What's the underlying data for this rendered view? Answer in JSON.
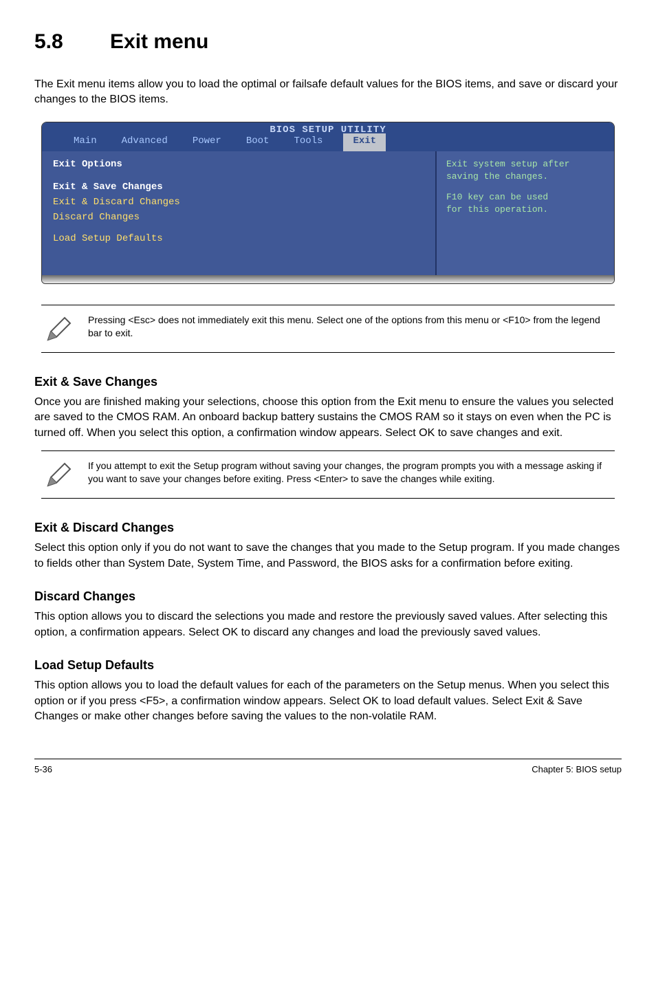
{
  "heading": {
    "number": "5.8",
    "title": "Exit menu"
  },
  "intro": "The Exit menu items allow you to load the optimal or failsafe default values for the BIOS items, and save or discard your changes to the BIOS items.",
  "bios": {
    "title": "BIOS SETUP UTILITY",
    "tabs": [
      "Main",
      "Advanced",
      "Power",
      "Boot",
      "Tools",
      "Exit"
    ],
    "active_tab": "Exit",
    "section_label": "Exit Options",
    "options": [
      {
        "label": "Exit & Save Changes",
        "selected": true
      },
      {
        "label": "Exit & Discard Changes",
        "yellow": true
      },
      {
        "label": "Discard Changes",
        "yellow": true
      },
      {
        "label": "Load Setup Defaults",
        "yellow": true
      }
    ],
    "help1": "Exit system setup after saving the changes.",
    "help2_a": "F10 key can be used",
    "help2_b": "for this operation."
  },
  "note1": "Pressing <Esc> does not immediately exit this menu. Select one of the options from this menu or <F10> from the legend bar to exit.",
  "sections": {
    "exit_save": {
      "title": "Exit & Save Changes",
      "body": "Once you are finished making your selections, choose this option from the Exit menu to ensure the values you selected are saved to the CMOS RAM. An onboard backup battery sustains the CMOS RAM so it stays on even when the PC is turned off. When you select this option, a confirmation window appears. Select OK to save changes and exit."
    },
    "exit_discard": {
      "title": "Exit & Discard Changes",
      "body": "Select this option only if you do not want to save the changes that you  made to the Setup program. If you made changes to fields other than System Date, System Time, and Password, the BIOS asks for a confirmation before exiting."
    },
    "discard": {
      "title": "Discard Changes",
      "body": "This option allows you to discard the selections you made and restore the previously saved values. After selecting this option, a confirmation appears. Select OK to discard any changes and load the previously saved values."
    },
    "load_defaults": {
      "title": "Load Setup Defaults",
      "body": "This option allows you to load the default values for each of the parameters on the Setup menus. When you select this option or if you press <F5>, a confirmation window appears. Select OK to load default values. Select Exit & Save Changes or make other changes before saving the values to the non-volatile RAM."
    }
  },
  "note2": " If you attempt to exit the Setup program without saving your changes, the program prompts you with a message asking if you want to save your changes before exiting. Press <Enter>  to save the  changes while exiting.",
  "footer": {
    "left": "5-36",
    "right": "Chapter 5: BIOS setup"
  }
}
